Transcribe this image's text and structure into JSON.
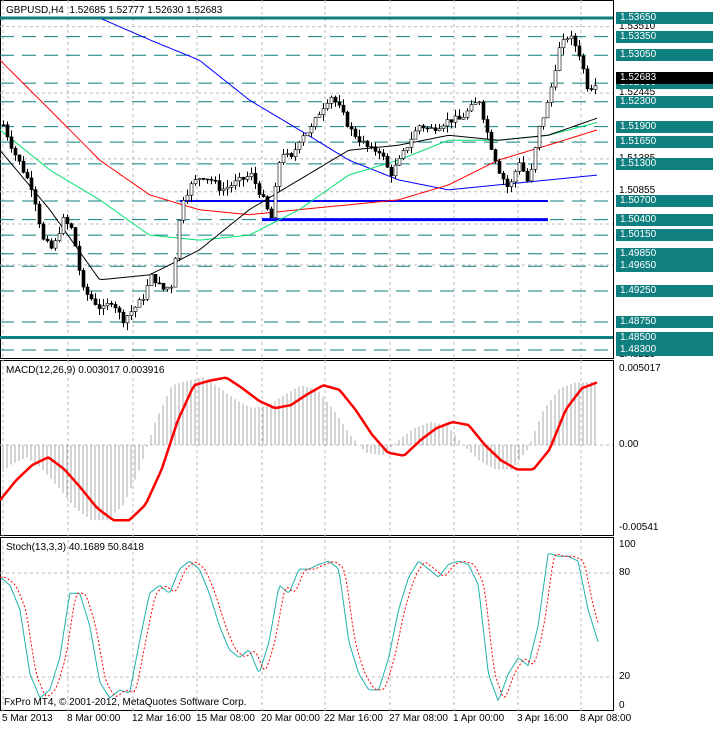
{
  "header": {
    "symbol": "GBPUSD,H4",
    "ohlc": "1.52685 1.52777 1.52630 1.52683"
  },
  "footer": {
    "copyright": "FxPro MT4, © 2001-2012, MetaQuotes Software Corp."
  },
  "price_axis": {
    "levels": [
      "1.53650",
      "1.53350",
      "1.53050",
      "1.52600",
      "1.52300",
      "1.51900",
      "1.51650",
      "1.51300",
      "1.50700",
      "1.50400",
      "1.50150",
      "1.49850",
      "1.49650",
      "1.49250",
      "1.48750",
      "1.48500",
      "1.48300"
    ],
    "plain": [
      "1.53510",
      "1.52445",
      "1.51385",
      "1.50855",
      "1.48215"
    ],
    "current": "1.52683"
  },
  "macd": {
    "title": "MACD(12,26,9) 0.003017 0.003916",
    "max": "0.005017",
    "zero": "0.00",
    "min": "-0.00541"
  },
  "stoch": {
    "title": "Stoch(13,3,3) 40.1689 50.8418",
    "max": "100",
    "l80": "80",
    "l20": "20",
    "min": "0"
  },
  "time_axis": [
    "5 Mar 2013",
    "8 Mar 00:00",
    "12 Mar 16:00",
    "15 Mar 08:00",
    "20 Mar 00:00",
    "22 Mar 16:00",
    "27 Mar 08:00",
    "1 Apr 00:00",
    "3 Apr 16:00",
    "8 Apr 08:00"
  ],
  "colors": {
    "level": "#0f7f7f",
    "support": "#0000ff",
    "macd_signal": "#ff0000",
    "stoch_main": "#20b2aa"
  },
  "chart_data": {
    "type": "line",
    "closes": [
      1.5193,
      1.5152,
      1.512,
      1.5088,
      1.5007,
      1.4991,
      1.504,
      1.5023,
      1.4927,
      1.4911,
      1.4894,
      1.4911,
      1.4878,
      1.4894,
      1.4911,
      1.4951,
      1.4927,
      1.4935,
      1.5072,
      1.5096,
      1.5112,
      1.5104,
      1.5088,
      1.5096,
      1.5104,
      1.5112,
      1.508,
      1.504,
      1.5152,
      1.5136,
      1.5176,
      1.5185,
      1.5217,
      1.5241,
      1.5217,
      1.5185,
      1.5168,
      1.5152,
      1.5152,
      1.5112,
      1.5136,
      1.5168,
      1.5193,
      1.5185,
      1.5193,
      1.5201,
      1.5201,
      1.5217,
      1.5233,
      1.5168,
      1.512,
      1.5088,
      1.5136,
      1.5096,
      1.5185,
      1.5233,
      1.5313,
      1.5338,
      1.5313,
      1.5249,
      1.5268
    ],
    "ma_blue": [
      null,
      null,
      1.5365,
      1.533,
      1.5297,
      1.5233,
      1.5185,
      1.5136,
      1.5104,
      1.5088,
      1.5096,
      1.5104,
      1.5112
    ],
    "ma_red": [
      1.5297,
      1.5217,
      1.5136,
      1.508,
      1.5056,
      1.5048,
      1.5056,
      1.5064,
      1.5072,
      1.5096,
      1.5136,
      1.516,
      1.5185
    ],
    "ma_green": [
      1.5185,
      1.512,
      1.5072,
      1.5015,
      1.5007,
      1.5015,
      1.5056,
      1.5112,
      1.5136,
      1.5168,
      1.5168,
      1.5176,
      1.5197
    ],
    "ma_black": [
      1.5152,
      1.5056,
      1.4943,
      1.4951,
      1.4991,
      1.5056,
      1.5104,
      1.5152,
      1.516,
      1.5176,
      1.5168,
      1.5176,
      1.5204
    ],
    "support_lines": [
      1.507,
      1.504
    ],
    "macd_signal": [
      -0.0036,
      -0.0023,
      -0.0013,
      -0.0008,
      -0.0016,
      -0.0028,
      -0.0041,
      -0.0049,
      -0.0049,
      -0.0039,
      -0.0016,
      0.0016,
      0.0039,
      0.0042,
      0.0044,
      0.0037,
      0.0029,
      0.0024,
      0.0026,
      0.0033,
      0.0039,
      0.0036,
      0.0023,
      0.0007,
      -0.0005,
      -0.0007,
      0.0003,
      0.0011,
      0.0015,
      0.0013,
      0.0,
      -0.001,
      -0.0016,
      -0.0016,
      -0.0003,
      0.0023,
      0.0037,
      0.0041
    ],
    "stoch_main": [
      80,
      75,
      60,
      20,
      5,
      10,
      30,
      70,
      70,
      50,
      15,
      5,
      10,
      8,
      40,
      70,
      75,
      70,
      85,
      90,
      85,
      70,
      50,
      35,
      30,
      35,
      20,
      40,
      75,
      70,
      85,
      85,
      88,
      90,
      85,
      40,
      20,
      10,
      10,
      30,
      60,
      80,
      90,
      85,
      80,
      88,
      90,
      88,
      75,
      20,
      3,
      20,
      30,
      25,
      50,
      95,
      93,
      93,
      90,
      60,
      40
    ]
  }
}
